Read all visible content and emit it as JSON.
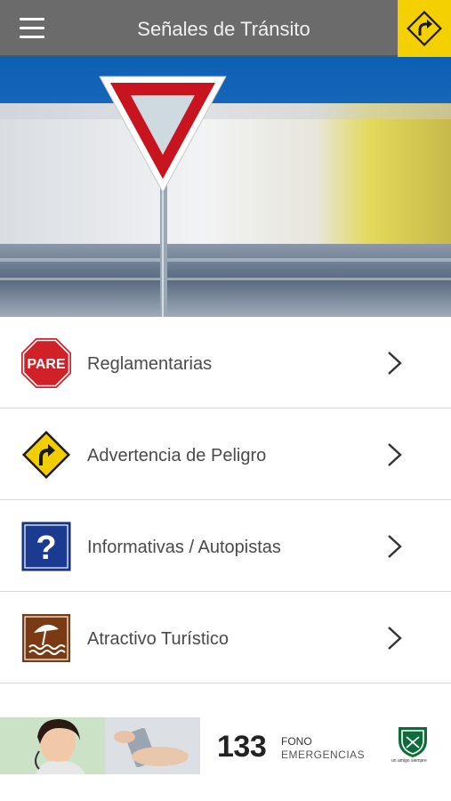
{
  "header": {
    "title": "Señales de Tránsito",
    "menu_icon": "hamburger-menu-icon",
    "corner_icon": "turn-right-warning-sign-icon",
    "bar_color": "#6b6b6b",
    "accent_color": "#f4d000"
  },
  "hero": {
    "image": "yield-sign-with-blurred-truck-photo"
  },
  "categories": [
    {
      "label": "Reglamentarias",
      "icon": "pare-stop-sign-icon",
      "icon_text": "PARE"
    },
    {
      "label": "Advertencia de Peligro",
      "icon": "curve-warning-sign-icon"
    },
    {
      "label": "Informativas / Autopistas",
      "icon": "question-info-sign-icon",
      "icon_text": "?"
    },
    {
      "label": "Atractivo Turístico",
      "icon": "beach-umbrella-tourist-sign-icon"
    }
  ],
  "footer": {
    "phone": "133",
    "line1": "FONO",
    "line2": "EMERGENCIAS",
    "motto": "un amigo siempre",
    "logo": "carabineros-shield-logo"
  }
}
